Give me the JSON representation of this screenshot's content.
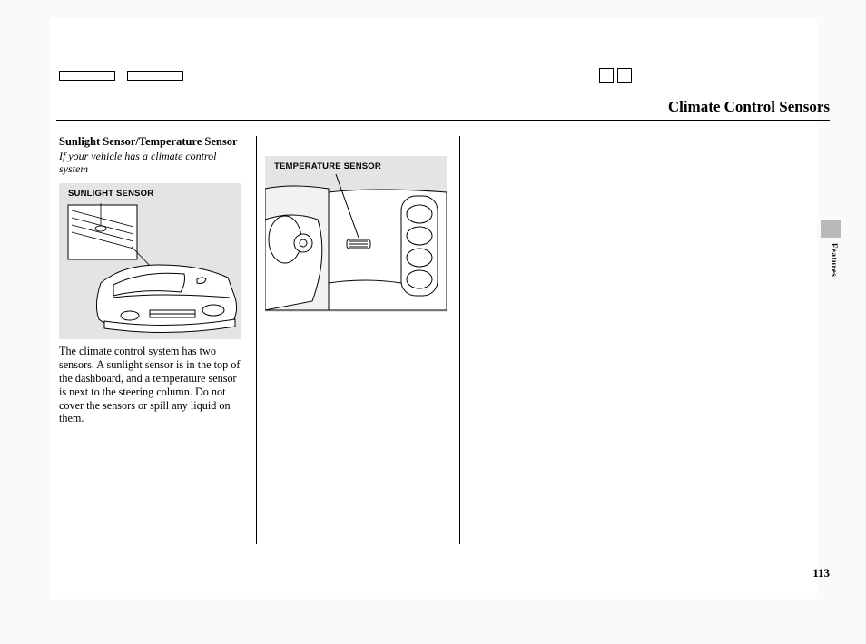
{
  "title": "Climate Control Sensors",
  "side_tab_label": "Features",
  "page_number": "113",
  "column1": {
    "subhead": "Sunlight Sensor/Temperature Sensor",
    "condition": "If your vehicle has a climate control system",
    "body": "The climate control system has two sensors. A sunlight sensor is in the top of the dashboard, and a temperature sensor is next to the steering column. Do not cover the sensors or spill any liquid on them."
  },
  "figures": {
    "sunlight": {
      "caption": "SUNLIGHT SENSOR"
    },
    "temperature": {
      "caption": "TEMPERATURE SENSOR"
    }
  }
}
